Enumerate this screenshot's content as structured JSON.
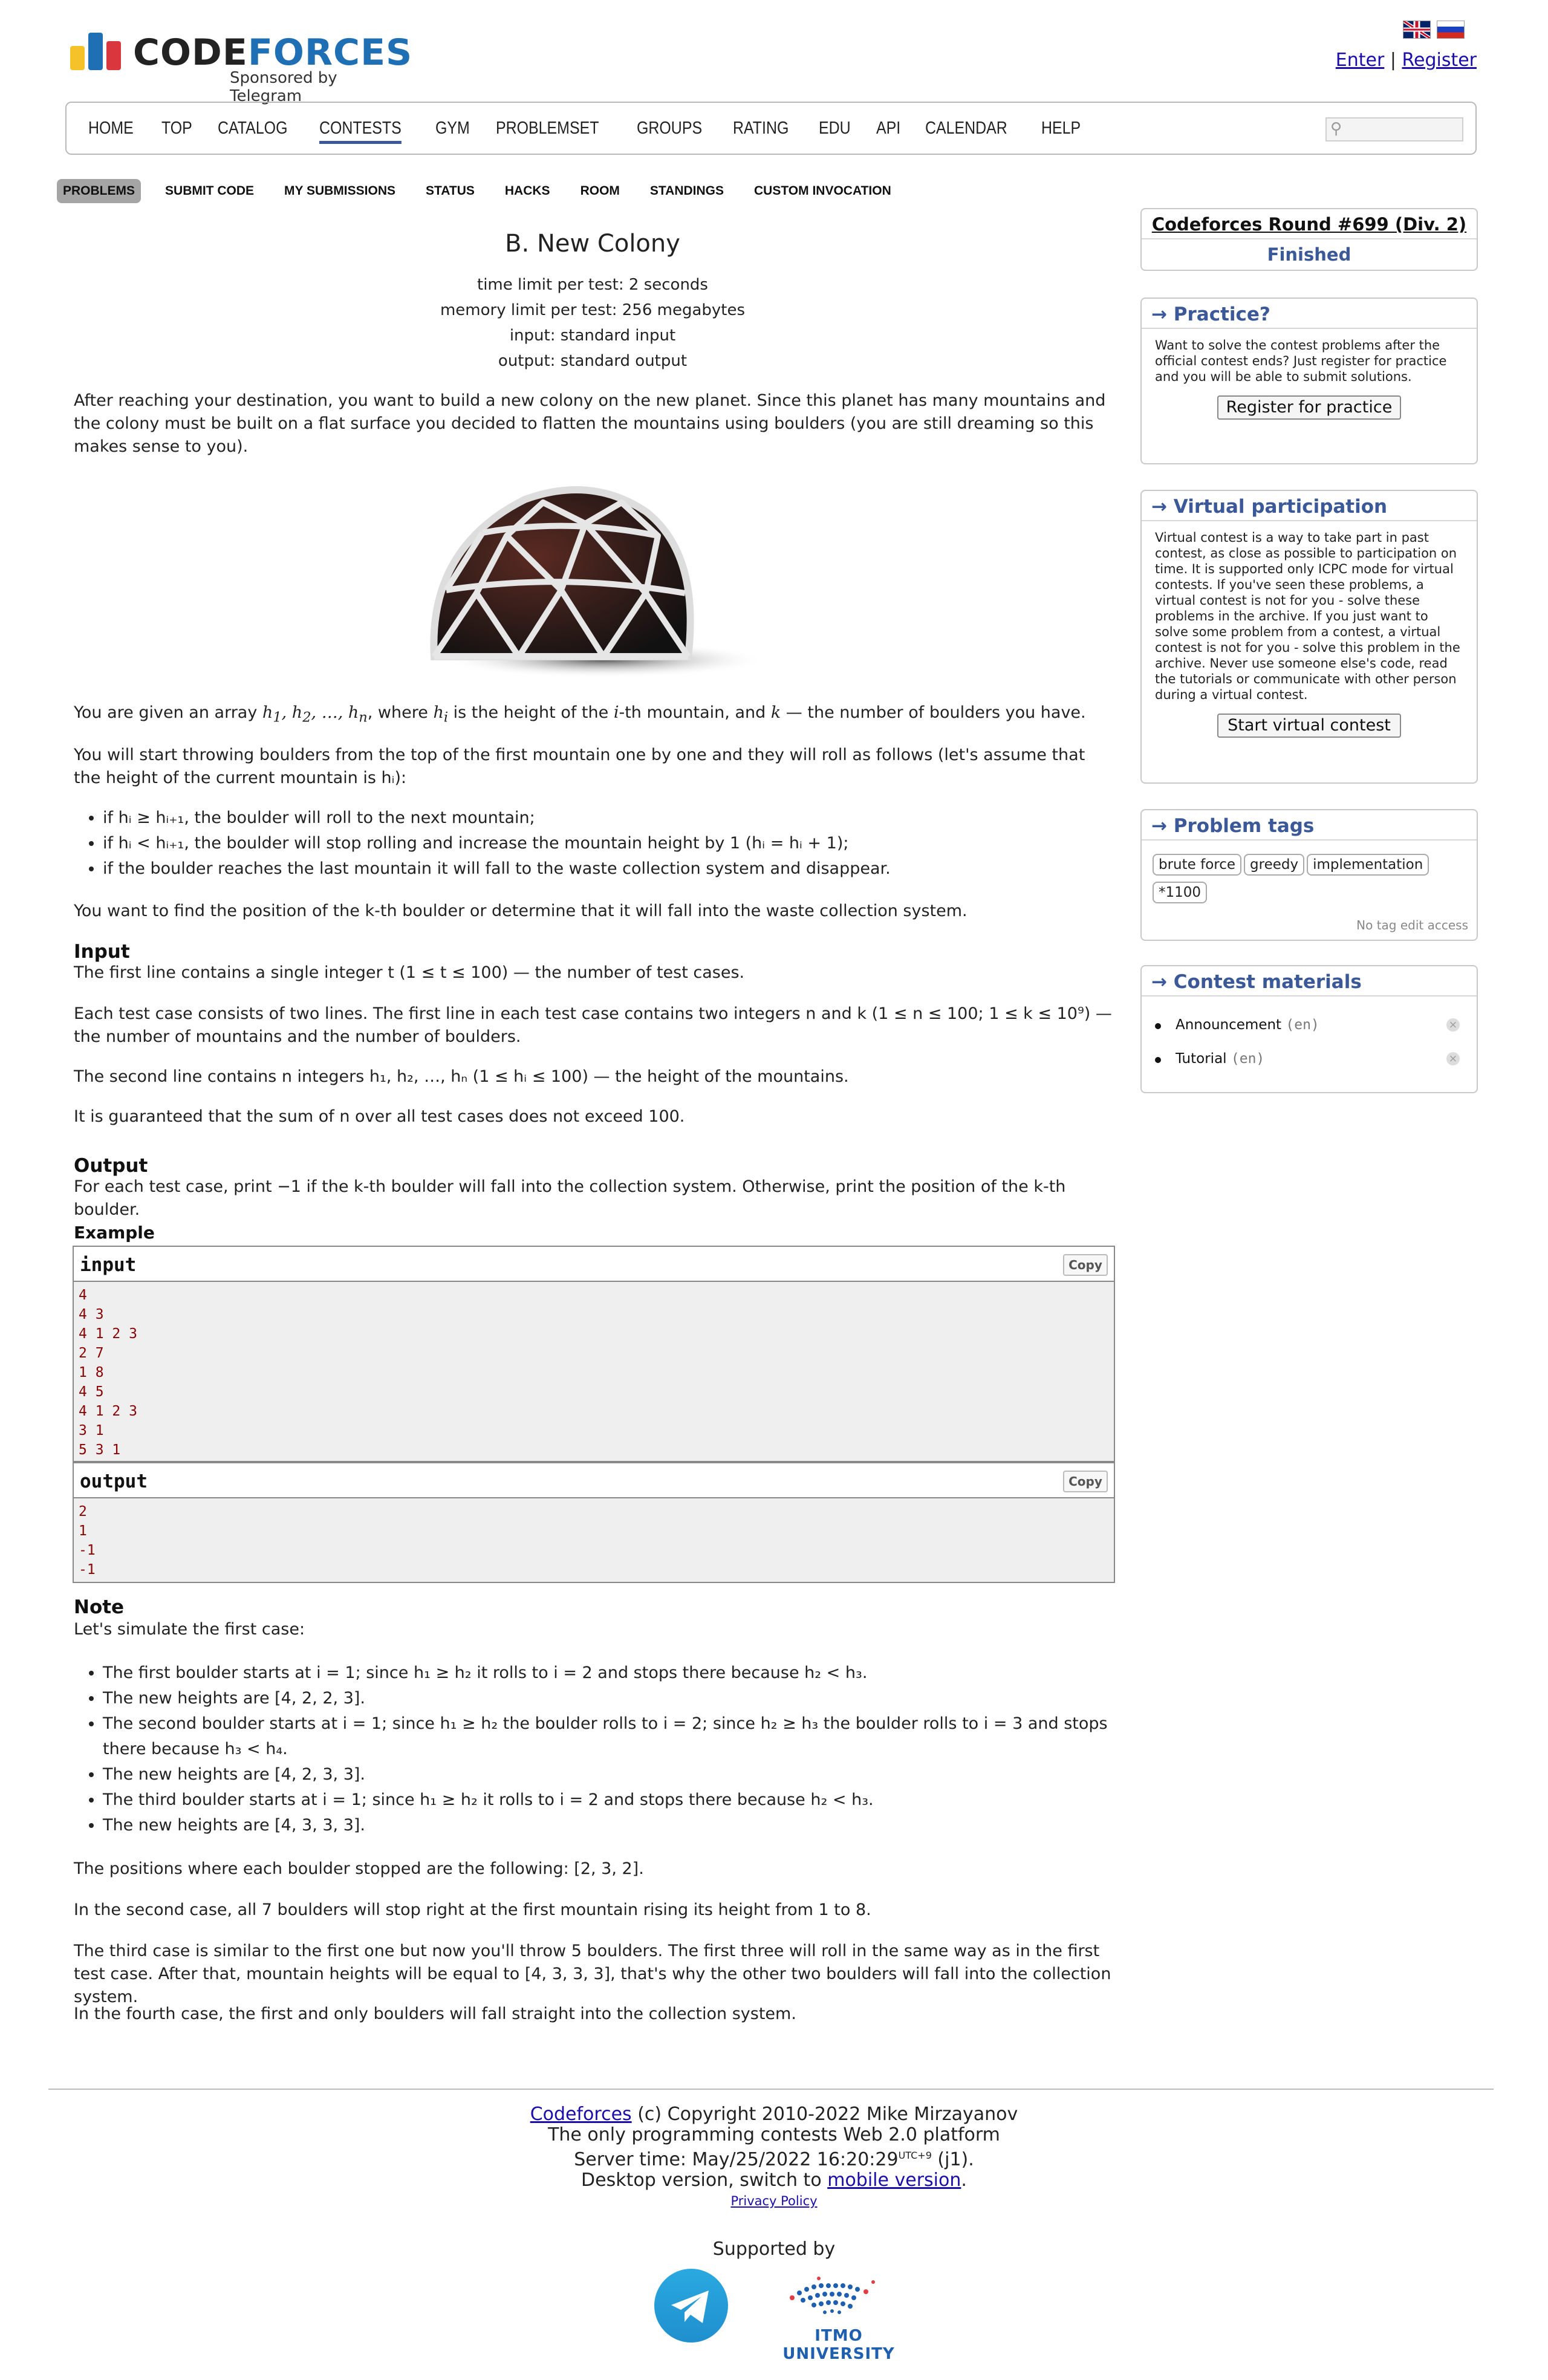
{
  "header": {
    "logo_text_code": "CODE",
    "logo_text_forces": "FORCES",
    "logo_sub": "Sponsored by Telegram",
    "enter": "Enter",
    "separator": "|",
    "register": "Register",
    "logo_colors": [
      "#f6c22a",
      "#1f6fb5",
      "#d9363e"
    ]
  },
  "mainnav": [
    "HOME",
    "TOP",
    "CATALOG",
    "CONTESTS",
    "GYM",
    "PROBLEMSET",
    "GROUPS",
    "RATING",
    "EDU",
    "API",
    "CALENDAR",
    "HELP"
  ],
  "mainnav_active": "CONTESTS",
  "subnav": [
    "PROBLEMS",
    "SUBMIT CODE",
    "MY SUBMISSIONS",
    "STATUS",
    "HACKS",
    "ROOM",
    "STANDINGS",
    "CUSTOM INVOCATION"
  ],
  "problem": {
    "title": "B. New Colony",
    "time_limit": "time limit per test: 2 seconds",
    "memory_limit": "memory limit per test: 256 megabytes",
    "input": "input: standard input",
    "output": "output: standard output",
    "legend_1": "After reaching your destination, you want to build a new colony on the new planet. Since this planet has many mountains and the colony must be built on a flat surface you decided to flatten the mountains using boulders (you are still dreaming so this makes sense to you).",
    "legend_2a": "You are given an array ",
    "legend_2b": ", where ",
    "legend_2c": " is the height of the ",
    "legend_2d": "-th mountain, and ",
    "legend_2e": " — the number of boulders you have.",
    "legend_3": "You will start throwing boulders from the top of the first mountain one by one and they will roll as follows (let's assume that the height of the current mountain is hᵢ):",
    "rules": [
      "if hᵢ ≥ hᵢ₊₁, the boulder will roll to the next mountain;",
      "if hᵢ < hᵢ₊₁, the boulder will stop rolling and increase the mountain height by 1 (hᵢ = hᵢ + 1);",
      "if the boulder reaches the last mountain it will fall to the waste collection system and disappear."
    ],
    "legend_4": "You want to find the position of the k-th boulder or determine that it will fall into the waste collection system.",
    "input_title": "Input",
    "input_1": "The first line contains a single integer t (1 ≤ t ≤ 100) — the number of test cases.",
    "input_2": "Each test case consists of two lines. The first line in each test case contains two integers n and k (1 ≤ n ≤ 100; 1 ≤ k ≤ 10⁹) — the number of mountains and the number of boulders.",
    "input_3": "The second line contains n integers h₁, h₂, …, hₙ (1 ≤ hᵢ ≤ 100) — the height of the mountains.",
    "input_4": "It is guaranteed that the sum of n over all test cases does not exceed 100.",
    "output_title": "Output",
    "output_1": "For each test case, print −1 if the k-th boulder will fall into the collection system. Otherwise, print the position of the k-th boulder.",
    "example_title": "Example",
    "example_input_label": "input",
    "example_output_label": "output",
    "copy": "Copy",
    "example_input": [
      "4",
      "4 3",
      "4 1 2 3",
      "2 7",
      "1 8",
      "4 5",
      "4 1 2 3",
      "3 1",
      "5 3 1"
    ],
    "example_output": [
      "2",
      "1",
      "-1",
      "-1"
    ],
    "note_title": "Note",
    "note_intro": "Let's simulate the first case:",
    "note_items": [
      "The first boulder starts at i = 1; since h₁ ≥ h₂ it rolls to i = 2 and stops there because h₂ < h₃.",
      "The new heights are [4, 2, 2, 3].",
      "The second boulder starts at i = 1; since h₁ ≥ h₂ the boulder rolls to i = 2; since h₂ ≥ h₃ the boulder rolls to i = 3 and stops there because h₃ < h₄.",
      "The new heights are [4, 2, 3, 3].",
      "The third boulder starts at i = 1; since h₁ ≥ h₂ it rolls to i = 2 and stops there because h₂ < h₃.",
      "The new heights are [4, 3, 3, 3]."
    ],
    "note_2": "The positions where each boulder stopped are the following: [2, 3, 2].",
    "note_3": "In the second case, all 7 boulders will stop right at the first mountain rising its height from 1 to 8.",
    "note_4": "The third case is similar to the first one but now you'll throw 5 boulders. The first three will roll in the same way as in the first test case. After that, mountain heights will be equal to [4, 3, 3, 3], that's why the other two boulders will fall into the collection system.",
    "note_5": "In the fourth case, the first and only boulders will fall straight into the collection system."
  },
  "sidebar": {
    "round_name": "Codeforces Round #699 (Div. 2)",
    "round_status": "Finished",
    "practice_title": "→ Practice?",
    "practice_text": "Want to solve the contest problems after the official contest ends? Just register for practice and you will be able to submit solutions.",
    "practice_button": "Register for practice",
    "virtual_title": "→ Virtual participation",
    "virtual_text": "Virtual contest is a way to take part in past contest, as close as possible to participation on time. It is supported only ICPC mode for virtual contests. If you've seen these problems, a virtual contest is not for you - solve these problems in the archive. If you just want to solve some problem from a contest, a virtual contest is not for you - solve this problem in the archive. Never use someone else's code, read the tutorials or communicate with other person during a virtual contest.",
    "virtual_button": "Start virtual contest",
    "tags_title": "→ Problem tags",
    "tags": [
      "brute force",
      "greedy",
      "implementation",
      "*1100"
    ],
    "tags_note": "No tag edit access",
    "materials_title": "→ Contest materials",
    "materials": [
      {
        "name": "Announcement",
        "lang": "(en)"
      },
      {
        "name": "Tutorial",
        "lang": "(en)"
      }
    ]
  },
  "footer": {
    "line1_link": "Codeforces",
    "line1_rest": " (c) Copyright 2010-2022 Mike Mirzayanov",
    "line2": "The only programming contests Web 2.0 platform",
    "line3a": "Server time: May/25/2022 16:20:29",
    "line3_sup": "UTC+9",
    "line3b": " (j1).",
    "line4a": "Desktop version, switch to ",
    "line4_link": "mobile version",
    "line4b": ".",
    "privacy": "Privacy Policy",
    "supported": "Supported by",
    "itmo": "ITMO UNIVERSITY"
  }
}
